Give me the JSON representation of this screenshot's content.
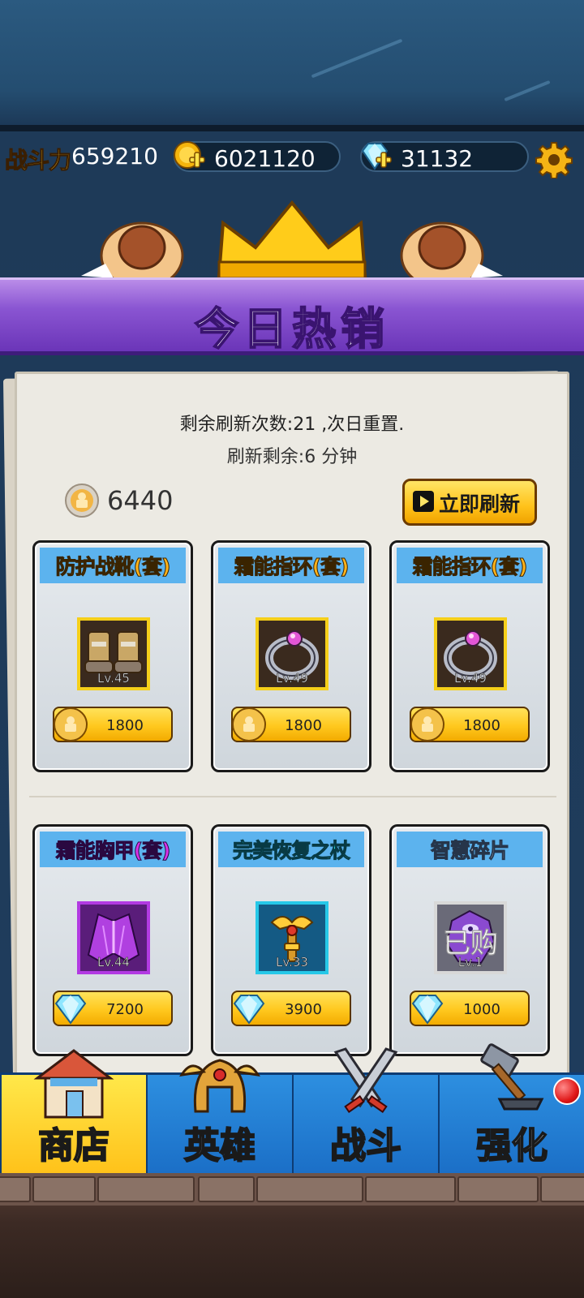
{
  "stats": {
    "power_label": "战斗力",
    "power_value": "659210",
    "gold_value": "6021120",
    "gem_value": "31132"
  },
  "banner": {
    "title": "今日热销"
  },
  "shop": {
    "refresh_count_text": "剩余刷新次数:21 ,次日重置.",
    "refresh_timer_text": "刷新剩余:6 分钟",
    "token_balance": "6440",
    "refresh_button_label": "立即刷新"
  },
  "items": [
    {
      "name": "防护战靴(套)",
      "level": "Lv.45",
      "price": "1800",
      "currency": "token",
      "title_color": "orange",
      "icon": "boots-icon"
    },
    {
      "name": "霜能指环(套)",
      "level": "Lv.49",
      "price": "1800",
      "currency": "token",
      "title_color": "orange",
      "icon": "ring-icon"
    },
    {
      "name": "霜能指环(套)",
      "level": "Lv.49",
      "price": "1800",
      "currency": "token",
      "title_color": "orange",
      "icon": "ring-icon"
    },
    {
      "name": "霜能胸甲(套)",
      "level": "Lv.44",
      "price": "7200",
      "currency": "gem",
      "title_color": "purple",
      "icon": "armor-icon"
    },
    {
      "name": "完美恢复之杖",
      "level": "Lv.33",
      "price": "3900",
      "currency": "gem",
      "title_color": "cyan",
      "icon": "staff-icon"
    },
    {
      "name": "智慧碎片",
      "level": "Lv.1",
      "price": "1000",
      "currency": "gem",
      "title_color": "white",
      "icon": "shard-icon",
      "overlay": "已购"
    }
  ],
  "nav": {
    "tabs": [
      {
        "label": "商店",
        "active": true
      },
      {
        "label": "英雄",
        "active": false
      },
      {
        "label": "战斗",
        "active": false
      },
      {
        "label": "强化",
        "active": false
      }
    ]
  }
}
